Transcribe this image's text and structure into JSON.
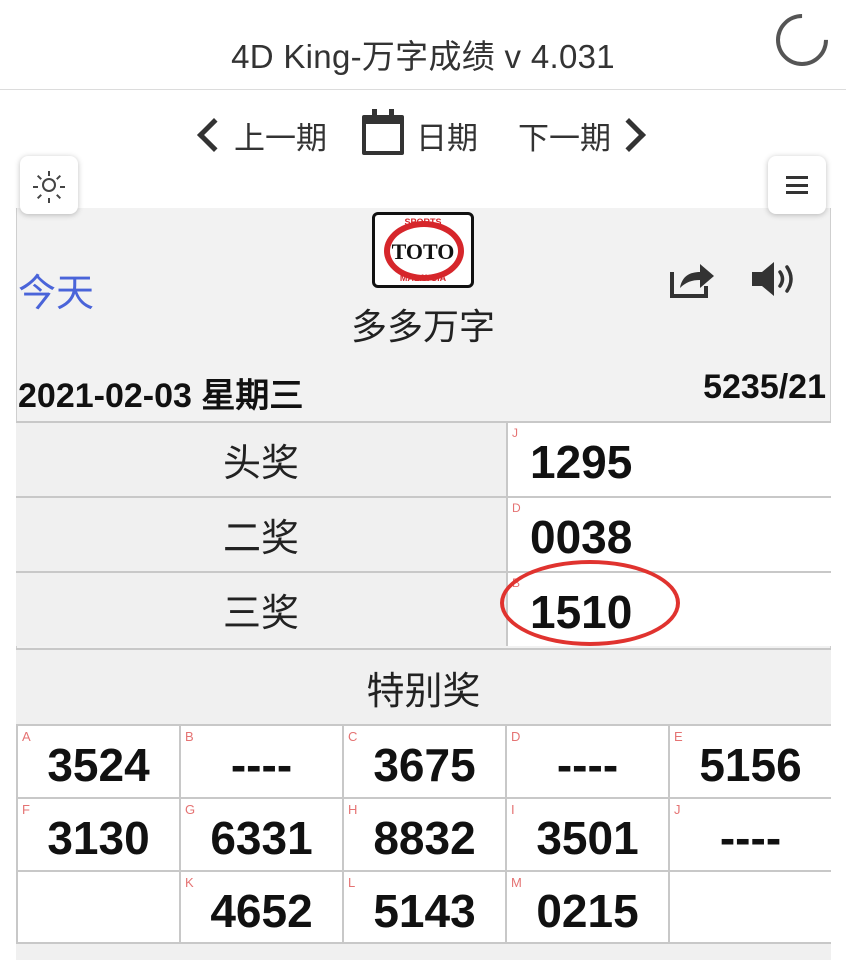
{
  "app": {
    "title": "4D King-万字成绩 v 4.031"
  },
  "nav": {
    "prev": "上一期",
    "date": "日期",
    "next": "下一期"
  },
  "header": {
    "today": "今天",
    "logo_text": "TOTO",
    "logo_top": "SPORTS",
    "logo_bottom": "MALAYSIA",
    "brand": "多多万字",
    "date": "2021-02-03 星期三",
    "draw_no": "5235/21"
  },
  "prizes": [
    {
      "label": "头奖",
      "letter": "J",
      "number": "1295"
    },
    {
      "label": "二奖",
      "letter": "D",
      "number": "0038"
    },
    {
      "label": "三奖",
      "letter": "B",
      "number": "1510"
    }
  ],
  "special": {
    "title": "特别奖",
    "cells": [
      {
        "letter": "A",
        "number": "3524"
      },
      {
        "letter": "B",
        "number": "----"
      },
      {
        "letter": "C",
        "number": "3675"
      },
      {
        "letter": "D",
        "number": "----"
      },
      {
        "letter": "E",
        "number": "5156"
      },
      {
        "letter": "F",
        "number": "3130"
      },
      {
        "letter": "G",
        "number": "6331"
      },
      {
        "letter": "H",
        "number": "8832"
      },
      {
        "letter": "I",
        "number": "3501"
      },
      {
        "letter": "J",
        "number": "----"
      },
      {
        "letter": "",
        "number": ""
      },
      {
        "letter": "K",
        "number": "4652"
      },
      {
        "letter": "L",
        "number": "5143"
      },
      {
        "letter": "M",
        "number": "0215"
      },
      {
        "letter": "",
        "number": ""
      }
    ]
  },
  "colors": {
    "today_link": "#4a64d9",
    "highlight_circle": "#e0332f",
    "prize_letter": "#e57373"
  },
  "icons": [
    "loading-spinner-icon",
    "chevron-left-icon",
    "calendar-icon",
    "chevron-right-icon",
    "sun-icon",
    "menu-icon",
    "share-icon",
    "speaker-icon"
  ]
}
